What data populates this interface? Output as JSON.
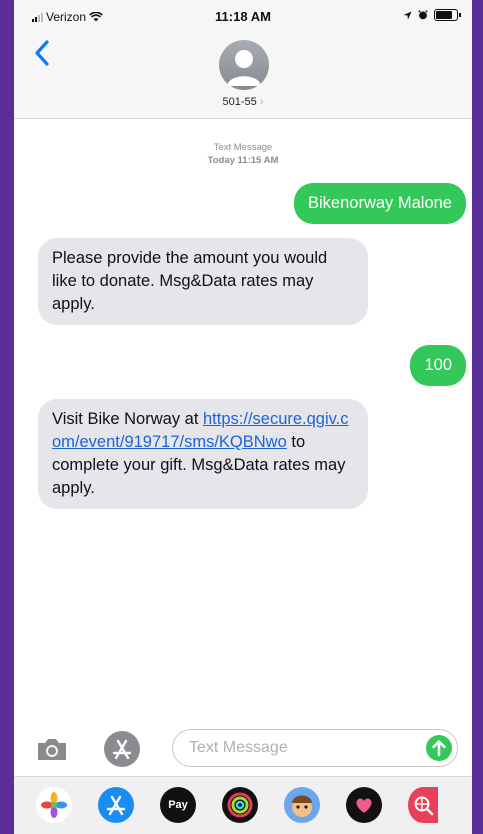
{
  "status_bar": {
    "carrier": "Verizon",
    "time": "11:18 AM"
  },
  "contact": {
    "name": "501-55"
  },
  "thread": {
    "label": "Text Message",
    "timestamp": "Today 11:15 AM"
  },
  "messages": [
    {
      "direction": "sent",
      "text": "Bikenorway Malone"
    },
    {
      "direction": "received",
      "text": "Please provide the amount you would like to donate. Msg&Data rates may apply."
    },
    {
      "direction": "sent",
      "text": "100"
    },
    {
      "direction": "received",
      "pre": "Visit Bike Norway at ",
      "link": "https://secure.qgiv.com/event/919717/sms/KQBNwo",
      "post": " to complete your gift. Msg&Data rates may apply."
    }
  ],
  "composer": {
    "placeholder": "Text Message"
  },
  "dock": {
    "apple_pay_label": "Pay",
    "items": [
      "photos-app",
      "app-store",
      "apple-pay",
      "activity",
      "memoji",
      "digital-touch",
      "web-search"
    ]
  },
  "colors": {
    "sent_bubble": "#34c759",
    "received_bubble": "#e5e5ea",
    "link": "#1a66d6",
    "accent": "#0a7aff",
    "background_frame": "#5a2f98"
  }
}
